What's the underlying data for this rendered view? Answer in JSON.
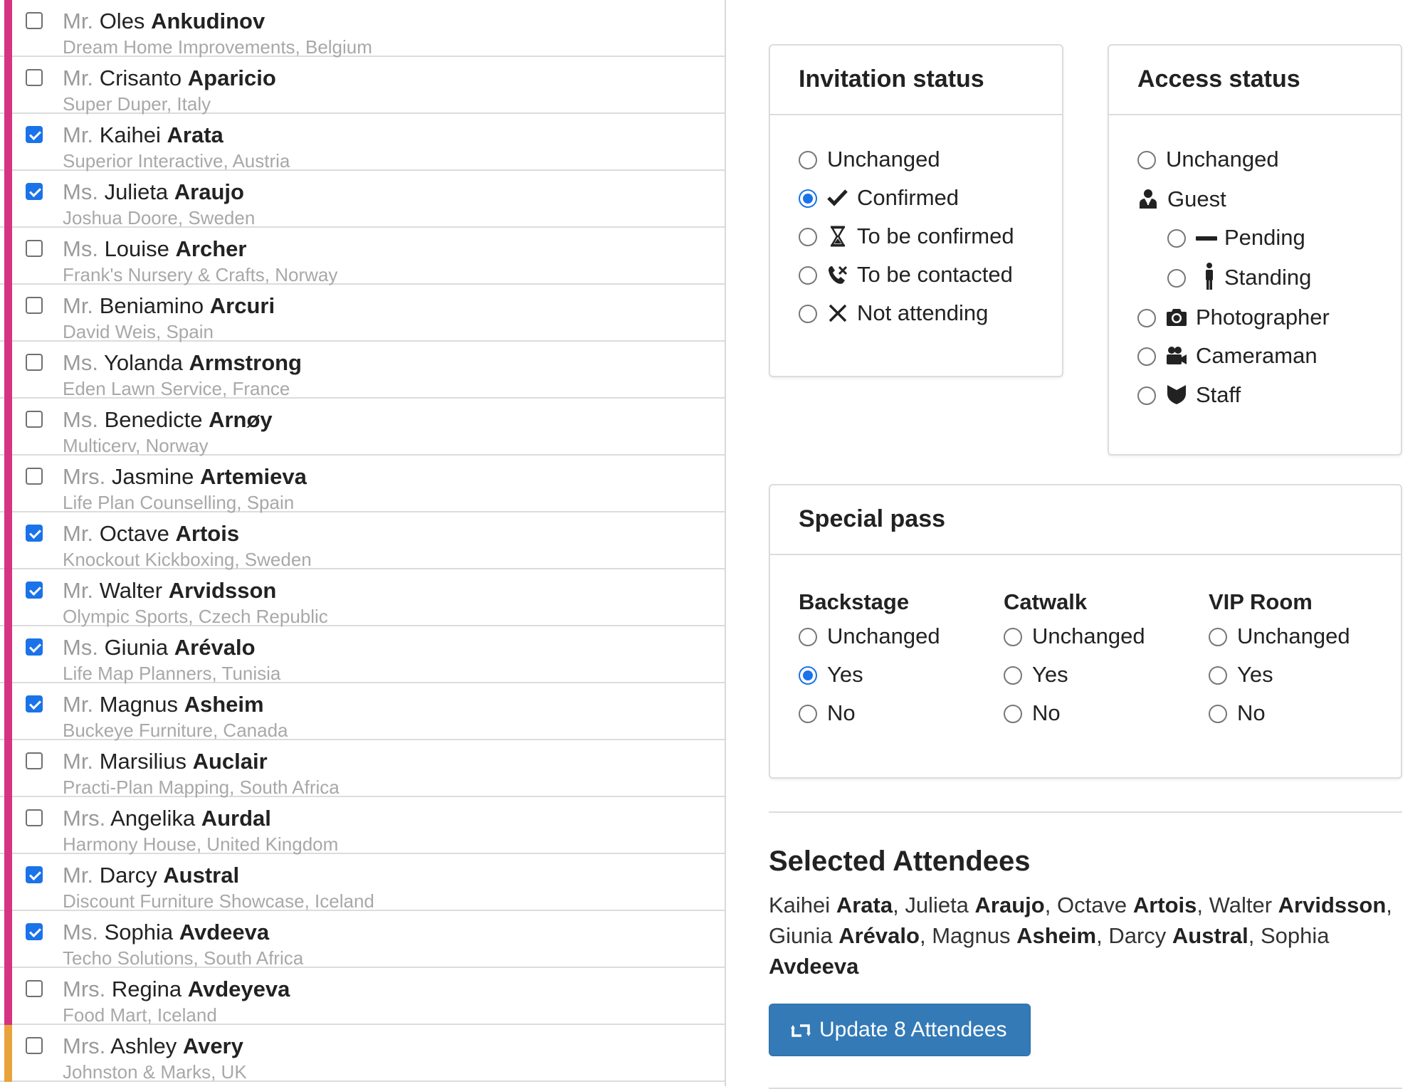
{
  "attendees": [
    {
      "salutation": "Mr.",
      "first": "Oles",
      "last": "Ankudinov",
      "company": "Dream Home Improvements, Belgium",
      "checked": false,
      "bar": "#d63384"
    },
    {
      "salutation": "Mr.",
      "first": "Crisanto",
      "last": "Aparicio",
      "company": "Super Duper, Italy",
      "checked": false,
      "bar": "#d63384"
    },
    {
      "salutation": "Mr.",
      "first": "Kaihei",
      "last": "Arata",
      "company": "Superior Interactive, Austria",
      "checked": true,
      "bar": "#d63384"
    },
    {
      "salutation": "Ms.",
      "first": "Julieta",
      "last": "Araujo",
      "company": "Joshua Doore, Sweden",
      "checked": true,
      "bar": "#d63384"
    },
    {
      "salutation": "Ms.",
      "first": "Louise",
      "last": "Archer",
      "company": "Frank's Nursery & Crafts, Norway",
      "checked": false,
      "bar": "#d63384"
    },
    {
      "salutation": "Mr.",
      "first": "Beniamino",
      "last": "Arcuri",
      "company": "David Weis, Spain",
      "checked": false,
      "bar": "#d63384"
    },
    {
      "salutation": "Ms.",
      "first": "Yolanda",
      "last": "Armstrong",
      "company": "Eden Lawn Service, France",
      "checked": false,
      "bar": "#d63384"
    },
    {
      "salutation": "Ms.",
      "first": "Benedicte",
      "last": "Arnøy",
      "company": "Multicerv, Norway",
      "checked": false,
      "bar": "#d63384"
    },
    {
      "salutation": "Mrs.",
      "first": "Jasmine",
      "last": "Artemieva",
      "company": "Life Plan Counselling, Spain",
      "checked": false,
      "bar": "#d63384"
    },
    {
      "salutation": "Mr.",
      "first": "Octave",
      "last": "Artois",
      "company": "Knockout Kickboxing, Sweden",
      "checked": true,
      "bar": "#d63384"
    },
    {
      "salutation": "Mr.",
      "first": "Walter",
      "last": "Arvidsson",
      "company": "Olympic Sports, Czech Republic",
      "checked": true,
      "bar": "#d63384"
    },
    {
      "salutation": "Ms.",
      "first": "Giunia",
      "last": "Arévalo",
      "company": "Life Map Planners, Tunisia",
      "checked": true,
      "bar": "#d63384"
    },
    {
      "salutation": "Mr.",
      "first": "Magnus",
      "last": "Asheim",
      "company": "Buckeye Furniture, Canada",
      "checked": true,
      "bar": "#d63384"
    },
    {
      "salutation": "Mr.",
      "first": "Marsilius",
      "last": "Auclair",
      "company": "Practi-Plan Mapping, South Africa",
      "checked": false,
      "bar": "#d63384"
    },
    {
      "salutation": "Mrs.",
      "first": "Angelika",
      "last": "Aurdal",
      "company": "Harmony House, United Kingdom",
      "checked": false,
      "bar": "#d63384"
    },
    {
      "salutation": "Mr.",
      "first": "Darcy",
      "last": "Austral",
      "company": "Discount Furniture Showcase, Iceland",
      "checked": true,
      "bar": "#d63384"
    },
    {
      "salutation": "Ms.",
      "first": "Sophia",
      "last": "Avdeeva",
      "company": "Techo Solutions, South Africa",
      "checked": true,
      "bar": "#d63384"
    },
    {
      "salutation": "Mrs.",
      "first": "Regina",
      "last": "Avdeyeva",
      "company": "Food Mart, Iceland",
      "checked": false,
      "bar": "#d63384"
    },
    {
      "salutation": "Mrs.",
      "first": "Ashley",
      "last": "Avery",
      "company": "Johnston & Marks, UK",
      "checked": false,
      "bar": "#e8a33d"
    }
  ],
  "invitation": {
    "title": "Invitation status",
    "options": [
      {
        "label": "Unchanged",
        "icon": "",
        "selected": false
      },
      {
        "label": "Confirmed",
        "icon": "check-icon",
        "selected": true
      },
      {
        "label": "To be confirmed",
        "icon": "hourglass-icon",
        "selected": false
      },
      {
        "label": "To be contacted",
        "icon": "phone-icon",
        "selected": false
      },
      {
        "label": "Not attending",
        "icon": "x-icon",
        "selected": false
      }
    ]
  },
  "access": {
    "title": "Access status",
    "unchanged": "Unchanged",
    "guest": "Guest",
    "pending": "Pending",
    "standing": "Standing",
    "photographer": "Photographer",
    "cameraman": "Cameraman",
    "staff": "Staff"
  },
  "special": {
    "title": "Special pass",
    "columns": [
      {
        "name": "Backstage",
        "unchanged": "Unchanged",
        "yes": "Yes",
        "no": "No",
        "selected": "yes"
      },
      {
        "name": "Catwalk",
        "unchanged": "Unchanged",
        "yes": "Yes",
        "no": "No",
        "selected": ""
      },
      {
        "name": "VIP Room",
        "unchanged": "Unchanged",
        "yes": "Yes",
        "no": "No",
        "selected": ""
      }
    ]
  },
  "selected": {
    "title": "Selected Attendees",
    "names": [
      {
        "first": "Kaihei",
        "last": "Arata"
      },
      {
        "first": "Julieta",
        "last": "Araujo"
      },
      {
        "first": "Octave",
        "last": "Artois"
      },
      {
        "first": "Walter",
        "last": "Arvidsson"
      },
      {
        "first": "Giunia",
        "last": "Arévalo"
      },
      {
        "first": "Magnus",
        "last": "Asheim"
      },
      {
        "first": "Darcy",
        "last": "Austral"
      },
      {
        "first": "Sophia",
        "last": "Avdeeva"
      }
    ]
  },
  "update_button": {
    "label": "Update 8 Attendees",
    "icon": "retweet-icon"
  },
  "colors": {
    "accent": "#1a73e8",
    "button": "#337ab7"
  }
}
